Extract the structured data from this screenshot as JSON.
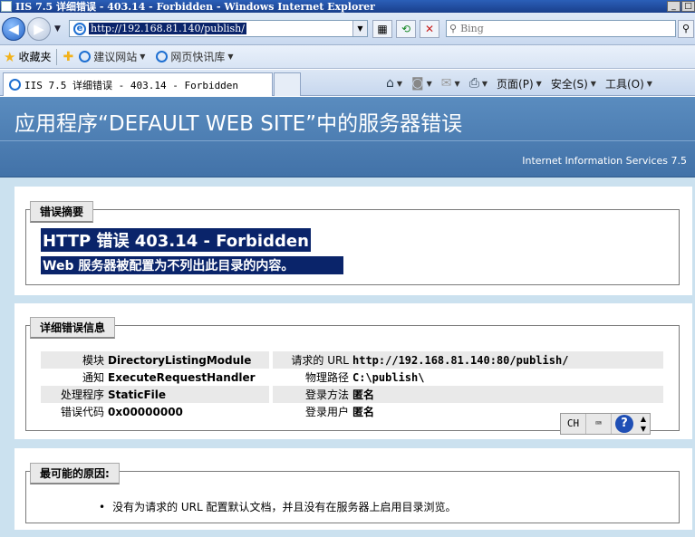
{
  "window": {
    "title": "IIS 7.5 详细错误 - 403.14 - Forbidden - Windows Internet Explorer"
  },
  "addressbar": {
    "url": "http://192.168.81.140/publish/",
    "search_placeholder": "Bing"
  },
  "favorites": {
    "label": "收藏夹",
    "items": [
      {
        "label": "建议网站"
      },
      {
        "label": "网页快讯库"
      }
    ]
  },
  "tab": {
    "title": "IIS 7.5 详细错误 - 403.14 - Forbidden"
  },
  "commandbar": {
    "page": "页面(P)",
    "safety": "安全(S)",
    "tools": "工具(O)"
  },
  "page": {
    "header_title": "应用程序“DEFAULT WEB SITE”中的服务器错误",
    "server": "Internet Information Services 7.5",
    "summary": {
      "legend": "错误摘要",
      "title": "HTTP 错误 403.14 - Forbidden",
      "description": "Web 服务器被配置为不列出此目录的内容。"
    },
    "details": {
      "legend": "详细错误信息",
      "rows": [
        {
          "k1": "模块",
          "v1": "DirectoryListingModule",
          "k2": "请求的 URL",
          "v2": "http://192.168.81.140:80/publish/"
        },
        {
          "k1": "通知",
          "v1": "ExecuteRequestHandler",
          "k2": "物理路径",
          "v2": "C:\\publish\\"
        },
        {
          "k1": "处理程序",
          "v1": "StaticFile",
          "k2": "登录方法",
          "v2": "匿名"
        },
        {
          "k1": "错误代码",
          "v1": "0x00000000",
          "k2": "登录用户",
          "v2": "匿名"
        }
      ]
    },
    "causes": {
      "legend": "最可能的原因:",
      "items": [
        "没有为请求的 URL 配置默认文档，并且没有在服务器上启用目录浏览。"
      ]
    }
  },
  "ime": {
    "lang": "CH"
  }
}
